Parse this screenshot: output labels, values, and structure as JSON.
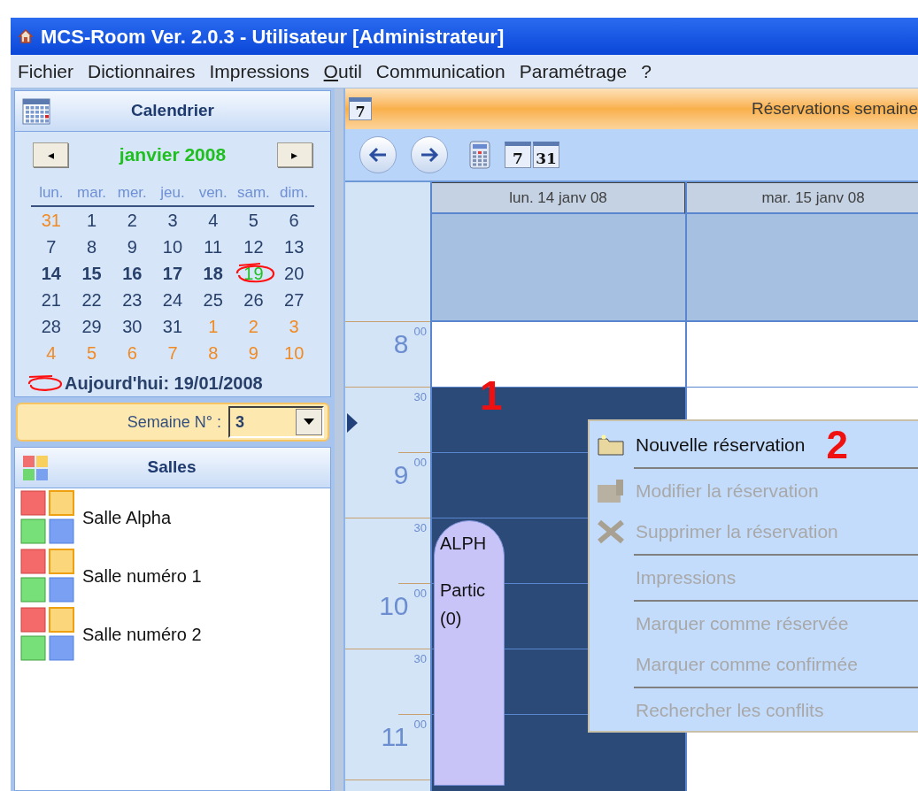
{
  "window": {
    "title": "MCS-Room Ver. 2.0.3 - Utilisateur [Administrateur]"
  },
  "menu": [
    {
      "label": "Fichier",
      "underline_first": false
    },
    {
      "label": "Dictionnaires",
      "underline_first": false
    },
    {
      "label": "Impressions",
      "underline_first": false
    },
    {
      "label": "Outil",
      "underline_first": true
    },
    {
      "label": "Communication",
      "underline_first": false
    },
    {
      "label": "Paramétrage",
      "underline_first": false
    },
    {
      "label": "?",
      "underline_first": false
    }
  ],
  "calendar": {
    "title": "Calendrier",
    "month": "janvier 2008",
    "prev": "◂",
    "next": "▸",
    "weekdays": [
      "lun.",
      "mar.",
      "mer.",
      "jeu.",
      "ven.",
      "sam.",
      "dim."
    ],
    "days": [
      {
        "text": "31",
        "other_month": true,
        "in_week": false,
        "today": false
      },
      {
        "text": "1",
        "other_month": false,
        "in_week": false,
        "today": false
      },
      {
        "text": "2",
        "other_month": false,
        "in_week": false,
        "today": false
      },
      {
        "text": "3",
        "other_month": false,
        "in_week": false,
        "today": false
      },
      {
        "text": "4",
        "other_month": false,
        "in_week": false,
        "today": false
      },
      {
        "text": "5",
        "other_month": false,
        "in_week": false,
        "today": false
      },
      {
        "text": "6",
        "other_month": false,
        "in_week": false,
        "today": false
      },
      {
        "text": "7",
        "other_month": false,
        "in_week": false,
        "today": false
      },
      {
        "text": "8",
        "other_month": false,
        "in_week": false,
        "today": false
      },
      {
        "text": "9",
        "other_month": false,
        "in_week": false,
        "today": false
      },
      {
        "text": "10",
        "other_month": false,
        "in_week": false,
        "today": false
      },
      {
        "text": "11",
        "other_month": false,
        "in_week": false,
        "today": false
      },
      {
        "text": "12",
        "other_month": false,
        "in_week": false,
        "today": false
      },
      {
        "text": "13",
        "other_month": false,
        "in_week": false,
        "today": false
      },
      {
        "text": "14",
        "other_month": false,
        "in_week": true,
        "today": false
      },
      {
        "text": "15",
        "other_month": false,
        "in_week": true,
        "today": false
      },
      {
        "text": "16",
        "other_month": false,
        "in_week": true,
        "today": false
      },
      {
        "text": "17",
        "other_month": false,
        "in_week": true,
        "today": false
      },
      {
        "text": "18",
        "other_month": false,
        "in_week": true,
        "today": false
      },
      {
        "text": "19",
        "other_month": false,
        "in_week": false,
        "today": true
      },
      {
        "text": "20",
        "other_month": false,
        "in_week": false,
        "today": false
      },
      {
        "text": "21",
        "other_month": false,
        "in_week": false,
        "today": false
      },
      {
        "text": "22",
        "other_month": false,
        "in_week": false,
        "today": false
      },
      {
        "text": "23",
        "other_month": false,
        "in_week": false,
        "today": false
      },
      {
        "text": "24",
        "other_month": false,
        "in_week": false,
        "today": false
      },
      {
        "text": "25",
        "other_month": false,
        "in_week": false,
        "today": false
      },
      {
        "text": "26",
        "other_month": false,
        "in_week": false,
        "today": false
      },
      {
        "text": "27",
        "other_month": false,
        "in_week": false,
        "today": false
      },
      {
        "text": "28",
        "other_month": false,
        "in_week": false,
        "today": false
      },
      {
        "text": "29",
        "other_month": false,
        "in_week": false,
        "today": false
      },
      {
        "text": "30",
        "other_month": false,
        "in_week": false,
        "today": false
      },
      {
        "text": "31",
        "other_month": false,
        "in_week": false,
        "today": false
      },
      {
        "text": "1",
        "other_month": true,
        "in_week": false,
        "today": false
      },
      {
        "text": "2",
        "other_month": true,
        "in_week": false,
        "today": false
      },
      {
        "text": "3",
        "other_month": true,
        "in_week": false,
        "today": false
      },
      {
        "text": "4",
        "other_month": true,
        "in_week": false,
        "today": false
      },
      {
        "text": "5",
        "other_month": true,
        "in_week": false,
        "today": false
      },
      {
        "text": "6",
        "other_month": true,
        "in_week": false,
        "today": false
      },
      {
        "text": "7",
        "other_month": true,
        "in_week": false,
        "today": false
      },
      {
        "text": "8",
        "other_month": true,
        "in_week": false,
        "today": false
      },
      {
        "text": "9",
        "other_month": true,
        "in_week": false,
        "today": false
      },
      {
        "text": "10",
        "other_month": true,
        "in_week": false,
        "today": false
      }
    ],
    "today_label": "Aujourd'hui: 19/01/2008",
    "week_label": "Semaine N° :",
    "week_value": "3"
  },
  "rooms": {
    "title": "Salles",
    "items": [
      "Salle Alpha",
      "Salle numéro 1",
      "Salle numéro 2"
    ]
  },
  "view": {
    "title": "Réservations semaine",
    "header_icon": "7",
    "week_button": "7",
    "month_button": "31",
    "days": [
      {
        "label": "lun. 14 janv 08",
        "slots": [
          {
            "selected": false
          },
          {
            "selected": true
          },
          {
            "selected": true
          },
          {
            "selected": true
          },
          {
            "selected": true
          },
          {
            "selected": true
          },
          {
            "selected": true
          }
        ],
        "annotation": "1"
      },
      {
        "label": "mar. 15 janv 08",
        "slots": [
          {
            "selected": false
          },
          {
            "selected": false
          }
        ]
      }
    ],
    "hours": [
      {
        "hour": "8",
        "minutes": [
          "00",
          "30"
        ]
      },
      {
        "hour": "9",
        "minutes": [
          "00",
          "30"
        ]
      },
      {
        "hour": "10",
        "minutes": [
          "00",
          "30"
        ]
      },
      {
        "hour": "11",
        "minutes": [
          "00"
        ]
      }
    ],
    "appointment": {
      "title": "ALPH",
      "detail": "Partic\n(0)"
    }
  },
  "context_menu": [
    {
      "kind": "item",
      "label": "Nouvelle réservation",
      "disabled": false,
      "annotation": "2"
    },
    {
      "kind": "separator"
    },
    {
      "kind": "item",
      "label": "Modifier la réservation",
      "disabled": true
    },
    {
      "kind": "item",
      "label": "Supprimer la réservation",
      "disabled": true
    },
    {
      "kind": "separator"
    },
    {
      "kind": "item",
      "label": "Impressions",
      "disabled": true
    },
    {
      "kind": "separator"
    },
    {
      "kind": "item",
      "label": "Marquer comme réservée",
      "disabled": true
    },
    {
      "kind": "item",
      "label": "Marquer comme confirmée",
      "disabled": true
    },
    {
      "kind": "separator"
    },
    {
      "kind": "item",
      "label": "Rechercher les conflits",
      "disabled": true
    }
  ]
}
